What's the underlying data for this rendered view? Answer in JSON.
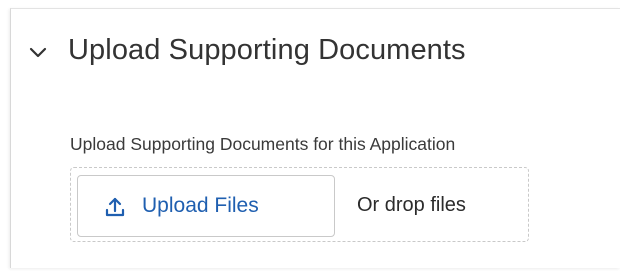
{
  "section": {
    "title": "Upload Supporting Documents",
    "icon": "chevron-down-icon"
  },
  "upload": {
    "field_label": "Upload Supporting Documents for this Application",
    "button_label": "Upload Files",
    "button_icon": "upload-icon",
    "drop_text": "Or drop files"
  },
  "colors": {
    "link_blue": "#1f5fb0",
    "text": "#333333",
    "border": "#c9c9c9"
  }
}
